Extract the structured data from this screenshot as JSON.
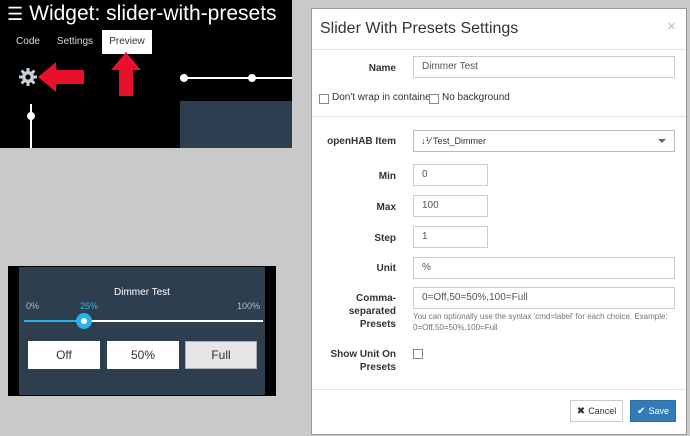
{
  "editor": {
    "title": "Widget: slider-with-presets",
    "tabs": [
      {
        "label": "Code"
      },
      {
        "label": "Settings"
      },
      {
        "label": "Preview",
        "active": true
      }
    ]
  },
  "widget": {
    "title": "Dimmer Test",
    "min_label": "0%",
    "value_label": "25%",
    "max_label": "100%",
    "value_fraction": 0.25,
    "presets": [
      {
        "label": "Off"
      },
      {
        "label": "50%"
      },
      {
        "label": "Full",
        "selected": true
      }
    ]
  },
  "dialog": {
    "title": "Slider With Presets Settings",
    "close": "×",
    "name_label": "Name",
    "name_value": "Dimmer Test",
    "dont_wrap_label": "Don't wrap in container",
    "no_background_label": "No background",
    "item_label": "openHAB Item",
    "item_icon": "sort-numeric-icon",
    "item_value": "Test_Dimmer",
    "min_label": "Min",
    "min_value": "0",
    "max_label": "Max",
    "max_value": "100",
    "step_label": "Step",
    "step_value": "1",
    "unit_label": "Unit",
    "unit_value": "%",
    "presets_label": "Comma-separated Presets",
    "presets_value": "0=Off,50=50%,100=Full",
    "presets_help": "You can optionally use the syntax 'cmd=label' for each choice. Example: 0=Off,50=50%,100=Full",
    "show_unit_label": "Show Unit On Presets",
    "cancel_label": "Cancel",
    "save_label": "Save"
  },
  "colors": {
    "accent": "#27b3e8",
    "arrow": "#e8102a",
    "widget_bg": "#2d3e4f",
    "primary": "#337ab7"
  }
}
